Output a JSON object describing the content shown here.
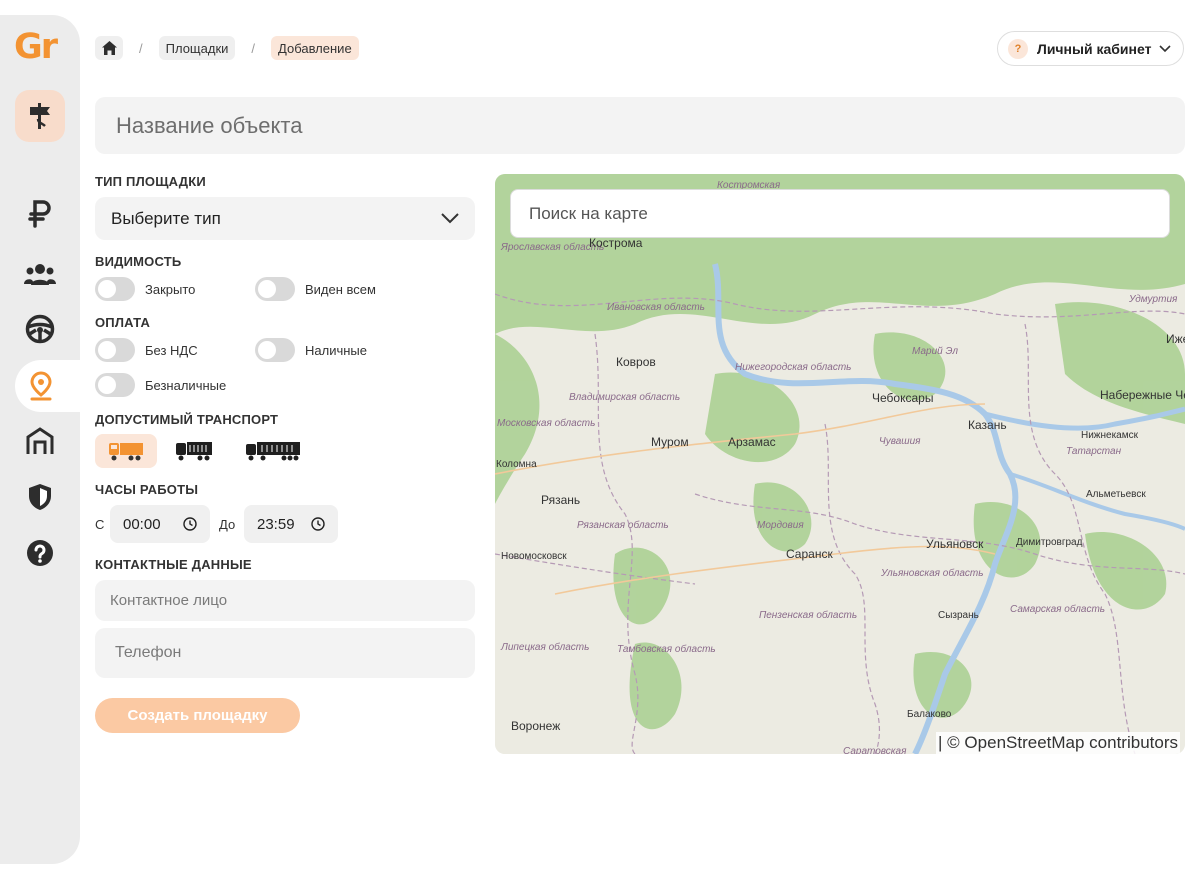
{
  "app": {
    "logo": "Gr"
  },
  "sidebar": {
    "items": [
      {
        "name": "finances",
        "icon": "ruble-icon"
      },
      {
        "name": "users",
        "icon": "users-icon"
      },
      {
        "name": "drivers",
        "icon": "steering-wheel-icon"
      },
      {
        "name": "places",
        "icon": "map-pin-icon",
        "active": true
      },
      {
        "name": "warehouses",
        "icon": "warehouse-icon"
      },
      {
        "name": "security",
        "icon": "shield-icon"
      },
      {
        "name": "help",
        "icon": "help-icon"
      }
    ]
  },
  "breadcrumb": {
    "items": [
      "Площадки",
      "Добавление"
    ],
    "separator": "/"
  },
  "account": {
    "badge": "?",
    "label": "Личный кабинет"
  },
  "form": {
    "title_placeholder": "Название объекта",
    "type": {
      "label": "ТИП ПЛОЩАДКИ",
      "value": "Выберите тип"
    },
    "visibility": {
      "label": "ВИДИМОСТЬ",
      "options": [
        "Закрыто",
        "Виден всем"
      ]
    },
    "payment": {
      "label": "ОПЛАТА",
      "options": [
        "Без НДС",
        "Наличные",
        "Безналичные"
      ]
    },
    "transport": {
      "label": "ДОПУСТИМЫЙ ТРАНСПОРТ"
    },
    "hours": {
      "label": "ЧАСЫ РАБОТЫ",
      "from_label": "С",
      "from_value": "00:00",
      "to_label": "До",
      "to_value": "23:59"
    },
    "contacts": {
      "label": "КОНТАКТНЫЕ ДАННЫЕ",
      "person_placeholder": "Контактное лицо",
      "phone_placeholder": "Телефон"
    },
    "submit_label": "Создать площадку"
  },
  "map": {
    "search_placeholder": "Поиск на карте",
    "attribution": "| © OpenStreetMap contributors",
    "cities": [
      "Кострома",
      "Ковров",
      "Чебоксары",
      "Набережные Челны",
      "Казань",
      "Нижнекамск",
      "Муром",
      "Арзамас",
      "Коломна",
      "Рязань",
      "Альметьевск",
      "Новомосковск",
      "Саранск",
      "Ульяновск",
      "Димитровград",
      "Сызрань",
      "Балаково",
      "Воронеж",
      "Ижевск"
    ],
    "regions": [
      "Костромская",
      "Ярославская область",
      "Ивановская область",
      "Нижегородская область",
      "Марий Эл",
      "Удмуртия",
      "Владимирская область",
      "Московская область",
      "Чувашия",
      "Татарстан",
      "Рязанская область",
      "Мордовия",
      "Ульяновская область",
      "Пензенская область",
      "Самарская область",
      "Липецкая область",
      "Тамбовская область",
      "Саратовская"
    ]
  },
  "colors": {
    "accent": "#f39332",
    "accent_light": "#fbe6d9",
    "button_disabled": "#fbc9a3",
    "sidebar_bg": "#ececec"
  }
}
